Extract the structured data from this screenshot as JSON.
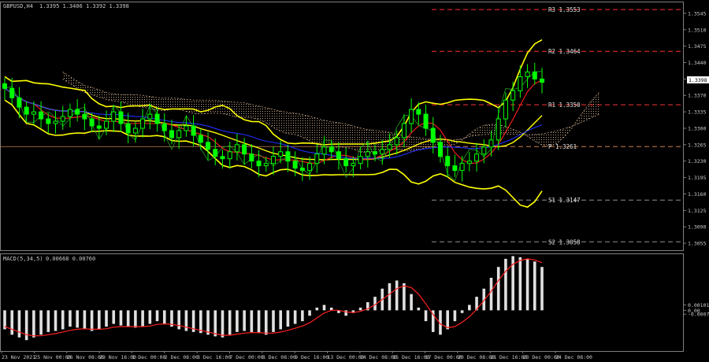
{
  "header": {
    "symbol_label": "GBPUSD,H4",
    "ohlc_label": "1.3395 1.3406 1.3392 1.3398"
  },
  "macd_header": {
    "label": "MACD(5,34,5)",
    "values": "0.00668 0.00760"
  },
  "price_marker": "1.3398",
  "colors": {
    "background": "#000000",
    "candle": "#00ff00",
    "bands": "#ffff00",
    "ma_fast": "#ff2020",
    "ma_slow": "#2030ff",
    "cloud": "#c0a080",
    "grid_text": "#c8c8c8",
    "pivot_red": "#ff3030",
    "pivot_gray": "#909090",
    "pivot_pp": "#d08050",
    "macd_hist": "#e0e0e0",
    "macd_signal": "#ff2020"
  },
  "pivots": [
    {
      "name": "R3",
      "label": "R3",
      "value": 1.3553,
      "text": "1.3553",
      "style": "red"
    },
    {
      "name": "R2",
      "label": "R2",
      "value": 1.3464,
      "text": "1.3464",
      "style": "red"
    },
    {
      "name": "R1",
      "label": "R1",
      "value": 1.335,
      "text": "1.3350",
      "style": "red"
    },
    {
      "name": "PP",
      "label": "P",
      "value": 1.3261,
      "text": "1.3261",
      "style": "pp"
    },
    {
      "name": "S1",
      "label": "S1",
      "value": 1.3147,
      "text": "1.3147",
      "style": "gray"
    },
    {
      "name": "S2",
      "label": "S2",
      "value": 1.3058,
      "text": "1.3058",
      "style": "gray"
    }
  ],
  "chart_data": [
    {
      "type": "candlestick",
      "title": "GBPUSD,H4",
      "ylim": [
        1.304,
        1.357
      ],
      "y_ticks": [
        "1.3545",
        "1.3510",
        "1.3475",
        "1.3440",
        "1.3405",
        "1.3370",
        "1.3335",
        "1.3300",
        "1.3265",
        "1.3230",
        "1.3195",
        "1.3160",
        "1.3125",
        "1.3090",
        "1.3055"
      ],
      "x_ticks": [
        "23 Nov 2021",
        "25 Nov 00:00",
        "26 Nov 08:00",
        "29 Nov 16:00",
        "1 Dec 00:00",
        "2 Dec 08:00",
        "3 Dec 16:00",
        "7 Dec 00:00",
        "8 Dec 08:00",
        "9 Dec 16:00",
        "13 Dec 00:00",
        "14 Dec 08:00",
        "15 Dec 16:00",
        "17 Dec 00:00",
        "20 Dec 08:00",
        "21 Dec 16:00",
        "23 Dec 00:00",
        "24 Dec 08:00"
      ],
      "close": [
        1.3385,
        1.3365,
        1.3345,
        1.333,
        1.3335,
        1.332,
        1.331,
        1.3315,
        1.3325,
        1.334,
        1.333,
        1.332,
        1.3305,
        1.33,
        1.3315,
        1.3335,
        1.331,
        1.329,
        1.33,
        1.332,
        1.333,
        1.331,
        1.3295,
        1.328,
        1.3295,
        1.3305,
        1.3285,
        1.327,
        1.3255,
        1.324,
        1.3235,
        1.325,
        1.3265,
        1.3245,
        1.323,
        1.322,
        1.3225,
        1.324,
        1.325,
        1.323,
        1.3215,
        1.321,
        1.3225,
        1.3245,
        1.326,
        1.325,
        1.3235,
        1.322,
        1.3225,
        1.324,
        1.325,
        1.3245,
        1.3255,
        1.3265,
        1.328,
        1.331,
        1.334,
        1.333,
        1.33,
        1.327,
        1.324,
        1.322,
        1.321,
        1.3225,
        1.323,
        1.3245,
        1.326,
        1.3275,
        1.332,
        1.336,
        1.338,
        1.341,
        1.342,
        1.3405,
        1.3398
      ],
      "price_marker": 1.3398
    },
    {
      "type": "bar",
      "title": "MACD(5,34,5) 0.00668 0.00760",
      "ylim": [
        -0.0075,
        0.0105
      ],
      "y_ticks": [
        "0.00101",
        "0.00",
        "-0.00071"
      ],
      "histogram": [
        -0.0035,
        -0.0045,
        -0.005,
        -0.0055,
        -0.005,
        -0.0045,
        -0.004,
        -0.0038,
        -0.0035,
        -0.003,
        -0.0032,
        -0.0035,
        -0.0038,
        -0.0035,
        -0.003,
        -0.0025,
        -0.0028,
        -0.003,
        -0.0032,
        -0.003,
        -0.0025,
        -0.002,
        -0.0025,
        -0.003,
        -0.0035,
        -0.0038,
        -0.004,
        -0.0042,
        -0.0045,
        -0.0048,
        -0.005,
        -0.0045,
        -0.004,
        -0.0038,
        -0.004,
        -0.0042,
        -0.0045,
        -0.004,
        -0.0035,
        -0.003,
        -0.0025,
        -0.002,
        -0.001,
        0.0005,
        0.001,
        0.0005,
        -0.0005,
        -0.001,
        -0.0005,
        0.0005,
        0.0015,
        0.0025,
        0.004,
        0.005,
        0.0055,
        0.005,
        0.003,
        0.0005,
        -0.002,
        -0.004,
        -0.0045,
        -0.0035,
        -0.002,
        -0.0005,
        0.001,
        0.0025,
        0.004,
        0.006,
        0.008,
        0.0095,
        0.01,
        0.0098,
        0.0095,
        0.009,
        0.008
      ],
      "signal": [
        -0.003,
        -0.0035,
        -0.004,
        -0.0045,
        -0.0047,
        -0.0047,
        -0.0045,
        -0.0043,
        -0.004,
        -0.0037,
        -0.0035,
        -0.0034,
        -0.0035,
        -0.0035,
        -0.0034,
        -0.0031,
        -0.003,
        -0.003,
        -0.003,
        -0.003,
        -0.0029,
        -0.0026,
        -0.0025,
        -0.0026,
        -0.0028,
        -0.0031,
        -0.0034,
        -0.0037,
        -0.004,
        -0.0043,
        -0.0046,
        -0.0046,
        -0.0044,
        -0.0042,
        -0.0041,
        -0.0041,
        -0.0042,
        -0.0042,
        -0.004,
        -0.0037,
        -0.0033,
        -0.0029,
        -0.0023,
        -0.0014,
        -0.0005,
        0.0,
        0.0,
        -0.0003,
        -0.0004,
        -0.0002,
        0.0003,
        0.001,
        0.002,
        0.003,
        0.004,
        0.0045,
        0.0042,
        0.003,
        0.0012,
        -0.0008,
        -0.0025,
        -0.0032,
        -0.003,
        -0.0022,
        -0.0012,
        0.0002,
        0.0018,
        0.0035,
        0.0055,
        0.0072,
        0.0085,
        0.0092,
        0.0095,
        0.0093,
        0.0088
      ]
    }
  ]
}
